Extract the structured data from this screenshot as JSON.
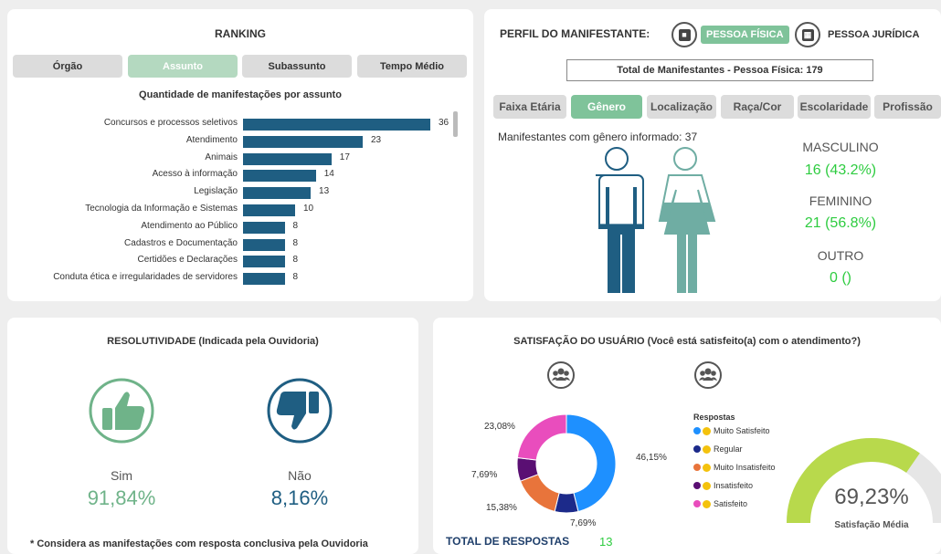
{
  "ranking": {
    "title": "RANKING",
    "tabs": [
      "Órgão",
      "Assunto",
      "Subassunto",
      "Tempo Médio"
    ],
    "active_tab": 1,
    "subtitle": "Quantidade de manifestações por assunto",
    "chart_data": {
      "type": "bar",
      "orientation": "horizontal",
      "title": "Quantidade de manifestações por assunto",
      "categories": [
        "Concursos e processos seletivos",
        "Atendimento",
        "Animais",
        "Acesso à informação",
        "Legislação",
        "Tecnologia da Informação e Sistemas",
        "Atendimento ao Público",
        "Cadastros e Documentação",
        "Certidões e Declarações",
        "Conduta ética e irregularidades de servidores"
      ],
      "values": [
        36,
        23,
        17,
        14,
        13,
        10,
        8,
        8,
        8,
        8
      ],
      "color": "#1f5e82",
      "xlim": [
        0,
        36
      ]
    }
  },
  "perfil": {
    "title": "PERFIL DO MANIFESTANTE:",
    "type_fisica": "PESSOA FÍSICA",
    "type_juridica": "PESSOA JURÍDICA",
    "total_label": "Total de Manifestantes - Pessoa Física: 179",
    "tabs": [
      "Faixa Etária",
      "Gênero",
      "Localização",
      "Raça/Cor",
      "Escolaridade",
      "Profissão"
    ],
    "active_tab": 1,
    "gender_info": "Manifestantes com gênero informado: 37",
    "masculino_label": "MASCULINO",
    "masculino_value": "16 (43.2%)",
    "feminino_label": "FEMININO",
    "feminino_value": "21 (56.8%)",
    "outro_label": "OUTRO",
    "outro_value": "0 ()",
    "colors": {
      "male": "#1f5e82",
      "female": "#6fada3"
    },
    "fill_fractions": {
      "male": 0.432,
      "female": 0.568
    }
  },
  "resolutividade": {
    "title": "RESOLUTIVIDADE (Indicada pela Ouvidoria)",
    "sim_label": "Sim",
    "sim_value": "91,84%",
    "nao_label": "Não",
    "nao_value": "8,16%",
    "footnote": "* Considera as manifestações com resposta conclusiva pela Ouvidoria",
    "colors": {
      "sim": "#6fb389",
      "nao": "#1f5e82"
    }
  },
  "satisfacao": {
    "title": "SATISFAÇÃO DO USUÁRIO (Você está satisfeito(a) com o atendimento?)",
    "legend_title": "Respostas",
    "total_label": "TOTAL DE RESPOSTAS",
    "total_value": "13",
    "gauge_value": "69,23%",
    "gauge_label": "Satisfação Média",
    "gauge_fraction": 0.6923,
    "chart_data": {
      "type": "pie",
      "donut": true,
      "labels": [
        "Muito Satisfeito",
        "Regular",
        "Muito Insatisfeito",
        "Insatisfeito",
        "Satisfeito"
      ],
      "values": [
        46.15,
        7.69,
        15.38,
        7.69,
        23.08
      ],
      "display": [
        "46,15%",
        "7,69%",
        "15,38%",
        "7,69%",
        "23,08%"
      ],
      "colors": [
        "#1e90ff",
        "#1c2a8a",
        "#e8743b",
        "#5a0f73",
        "#e94dbd"
      ]
    }
  }
}
